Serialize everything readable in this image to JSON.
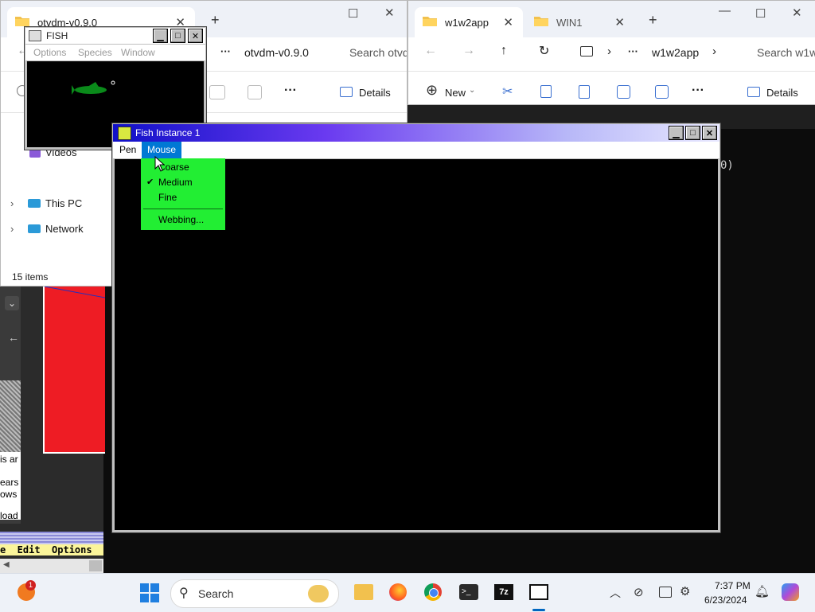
{
  "explorer_left": {
    "tab_active_label": "otvdm-v0.9.0",
    "address_folder": "otvdm-v0.9.0",
    "search_placeholder": "Search otvd",
    "details_label": "Details",
    "nav_items": [
      "Videos",
      "This PC",
      "Network"
    ],
    "status": "15 items"
  },
  "explorer_right": {
    "tab_active_label": "w1w2app",
    "tab_inactive_label": "WIN1",
    "address_folder": "w1w2app",
    "search_placeholder": "Search w1w",
    "new_label": "New",
    "details_label": "Details"
  },
  "fish_window": {
    "title": "FISH",
    "menu": [
      "Options",
      "Species",
      "Window"
    ]
  },
  "fish_instance": {
    "title": "Fish Instance 1",
    "menu": [
      "Pen",
      "Mouse"
    ],
    "dropdown": {
      "items": [
        "Coarse",
        "Medium",
        "Fine",
        "Webbing..."
      ],
      "checked_item": "Medium"
    }
  },
  "background_app": {
    "menu_fragment": "e  Edit  Options",
    "text_fragments": [
      "is ar",
      "ears",
      "ows",
      "load"
    ]
  },
  "terminal_fragment": "0)",
  "taskbar": {
    "search_label": "Search",
    "notification_badge": "1",
    "time": "7:37 PM",
    "date": "6/23/2024"
  },
  "colors": {
    "fish_titlebar_start": "#1010c8",
    "fish_titlebar_end": "#e0e0ff",
    "menu_highlight": "#0078d4",
    "dropdown_bg": "#22ee33"
  }
}
